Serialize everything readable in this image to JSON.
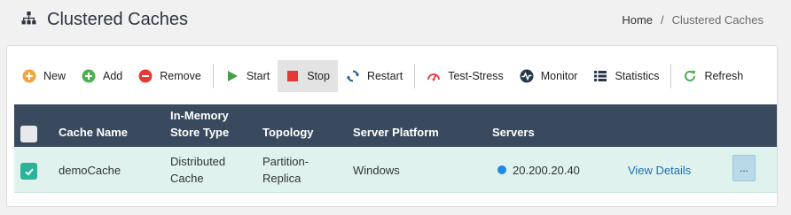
{
  "page": {
    "title": "Clustered Caches"
  },
  "breadcrumb": {
    "home": "Home",
    "separator": "/",
    "current": "Clustered Caches"
  },
  "toolbar": {
    "new": "New",
    "add": "Add",
    "remove": "Remove",
    "start": "Start",
    "stop": "Stop",
    "restart": "Restart",
    "test_stress": "Test-Stress",
    "monitor": "Monitor",
    "statistics": "Statistics",
    "refresh": "Refresh"
  },
  "table": {
    "headers": {
      "cache_name": "Cache Name",
      "store_type_1": "In-Memory",
      "store_type_2": "Store Type",
      "topology": "Topology",
      "platform": "Server Platform",
      "servers": "Servers"
    },
    "rows": [
      {
        "cache_name": "demoCache",
        "store_type_1": "Distributed",
        "store_type_2": "Cache",
        "topology_1": "Partition-",
        "topology_2": "Replica",
        "platform": "Windows",
        "server": "20.200.20.40",
        "details": "View Details",
        "more": "..."
      }
    ]
  },
  "colors": {
    "header_bg": "#3a4a5e",
    "row_selected": "#dff2ee",
    "checkbox_checked": "#2bb399",
    "server_status": "#1e88e5",
    "link": "#1d6fb8"
  }
}
